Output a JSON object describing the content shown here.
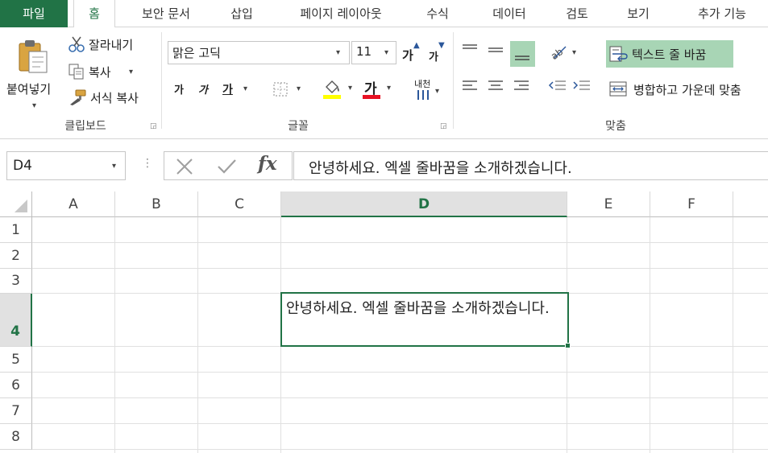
{
  "tabs": [
    {
      "label": "파일"
    },
    {
      "label": "홈"
    },
    {
      "label": "보안 문서"
    },
    {
      "label": "삽입"
    },
    {
      "label": "페이지 레이아웃"
    },
    {
      "label": "수식"
    },
    {
      "label": "데이터"
    },
    {
      "label": "검토"
    },
    {
      "label": "보기"
    },
    {
      "label": "추가 기능"
    }
  ],
  "clipboard": {
    "paste_label": "붙여넣기",
    "cut_label": "잘라내기",
    "copy_label": "복사",
    "format_painter_label": "서식 복사",
    "group_label": "클립보드"
  },
  "font": {
    "font_name": "맑은 고딕",
    "font_size": "11",
    "grow_label": "가",
    "shrink_label": "가",
    "bold_label": "가",
    "italic_label": "가",
    "underline_label": "가",
    "font_color_label": "가",
    "phonetic_label": "내천",
    "group_label": "글꼴",
    "highlight_color": "#ffff00",
    "font_color": "#e81123"
  },
  "alignment": {
    "wrap_text_label": "텍스트 줄 바꿈",
    "merge_center_label": "병합하고 가운데 맞춤",
    "group_label": "맞춤",
    "active_color": "#a8d5b5"
  },
  "formula_bar": {
    "name_box": "D4",
    "fx_label": "fx",
    "content": "안녕하세요. 엑셀 줄바꿈을 소개하겠습니다."
  },
  "grid": {
    "columns": [
      "A",
      "B",
      "C",
      "D",
      "E",
      "F"
    ],
    "rows": [
      "1",
      "2",
      "3",
      "4",
      "5",
      "6",
      "7",
      "8"
    ],
    "active_cell_text": "안녕하세요. 엑셀 줄바꿈을 소개하겠습니다."
  },
  "colors": {
    "accent": "#217346"
  }
}
